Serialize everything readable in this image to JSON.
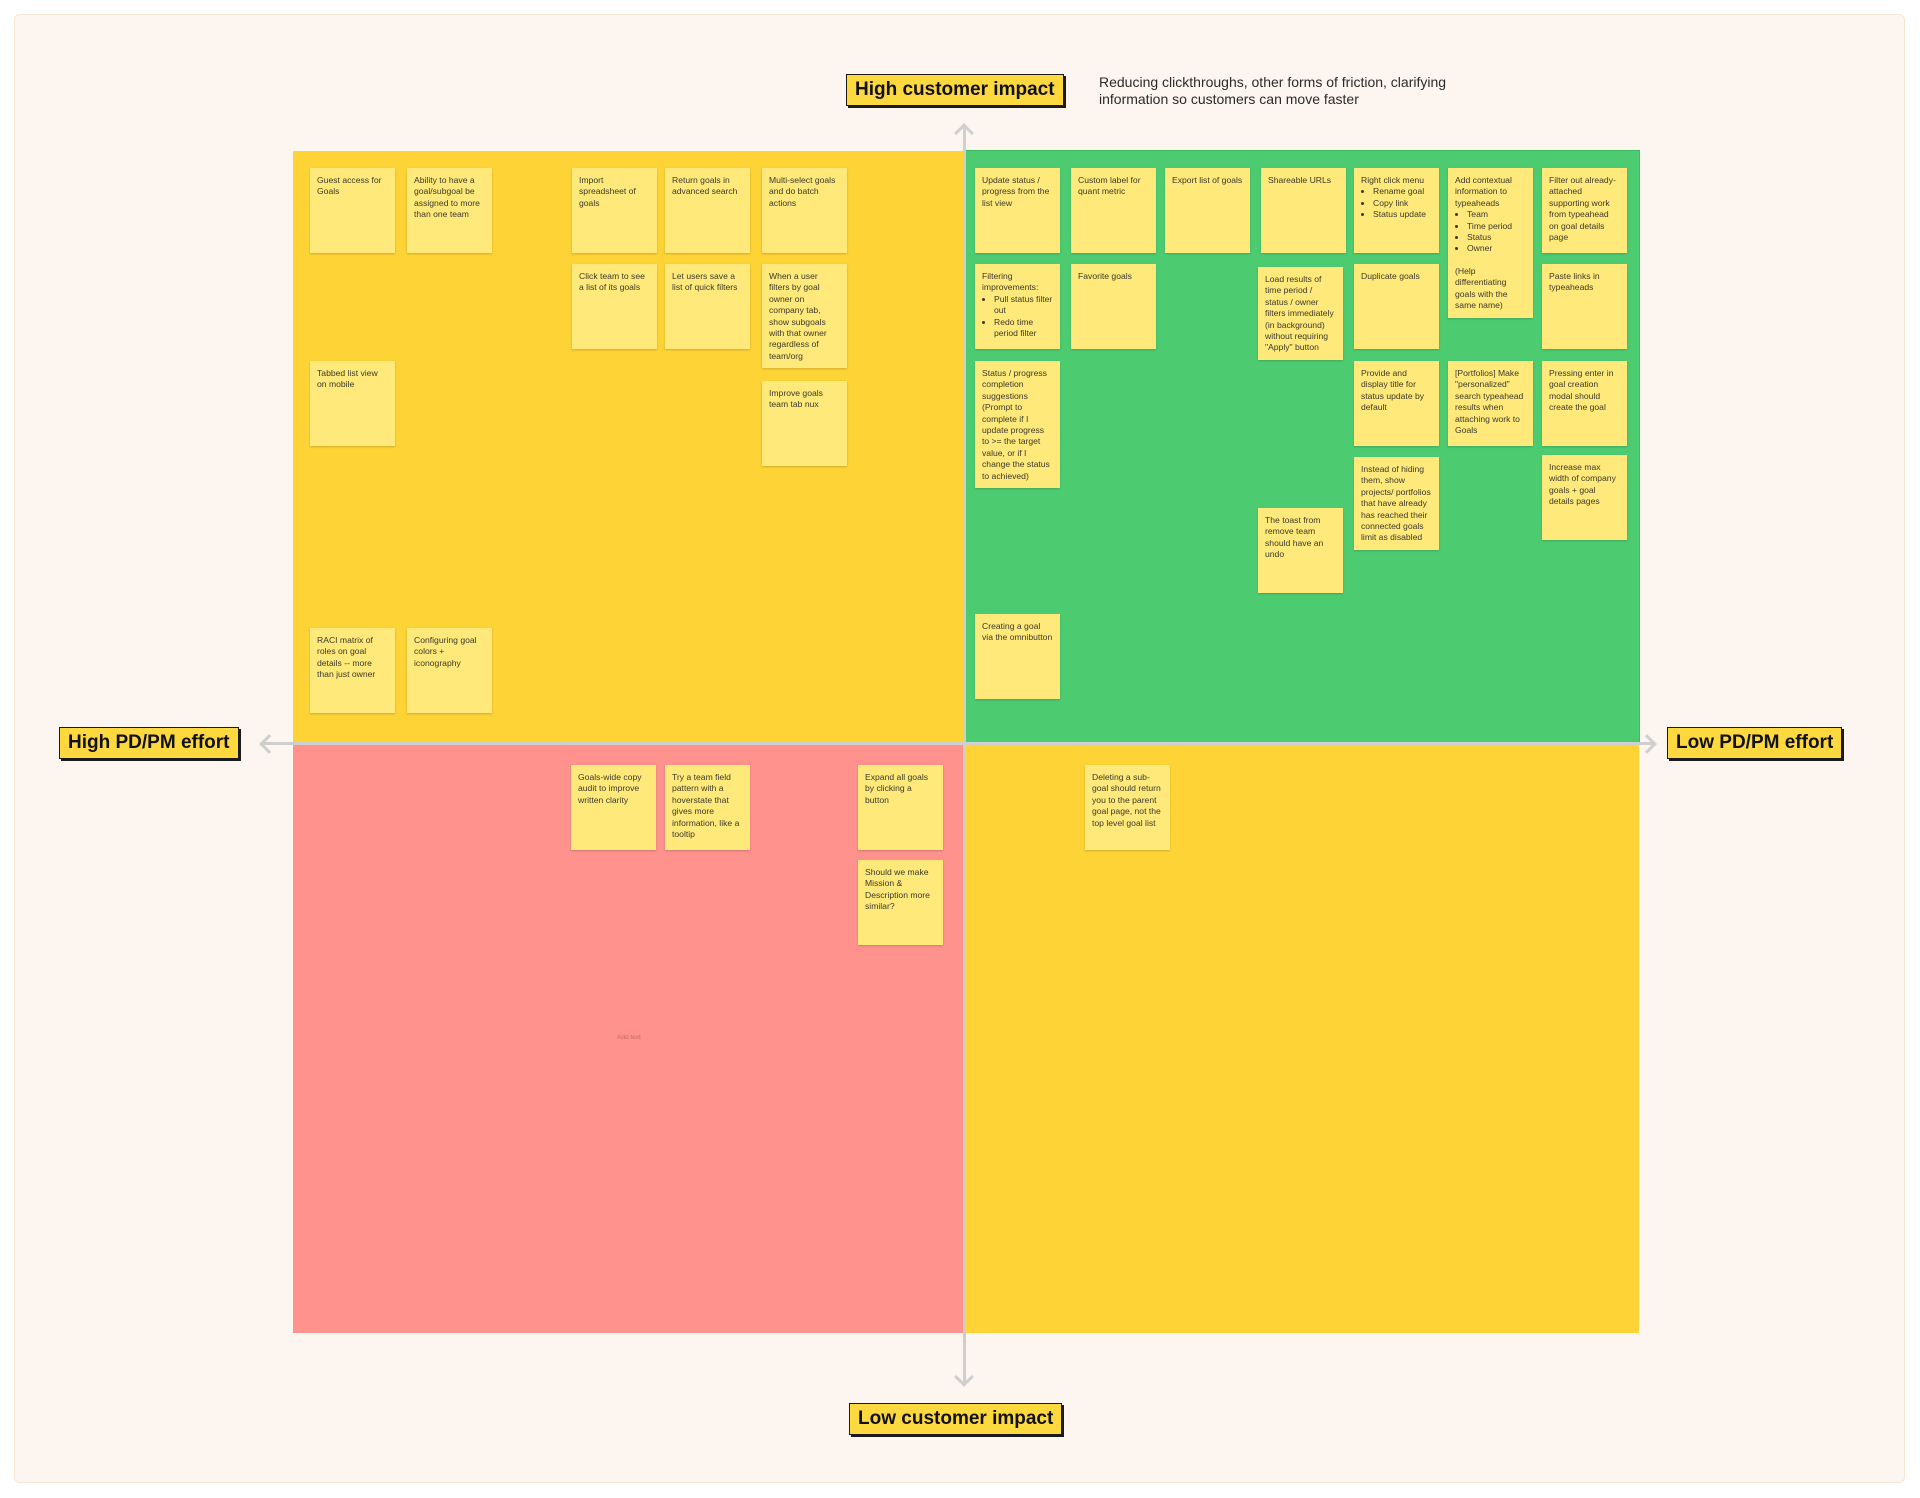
{
  "axes": {
    "top_label": "High customer impact",
    "bottom_label": "Low customer impact",
    "left_label": "High PD/PM effort",
    "right_label": "Low PD/PM effort",
    "top_description": "Reducing clickthroughs, other forms of friction, clarifying information so customers can move faster"
  },
  "colors": {
    "board": "#fdf6f0",
    "quadrant_top_left": "#fdd335",
    "quadrant_top_right": "#4dcb71",
    "quadrant_bottom_left": "#ff928c",
    "quadrant_bottom_right": "#fdd335",
    "sticky": "#ffe97a",
    "label_bg": "#fdd83f"
  },
  "quadrants": {
    "top_left": {
      "notes": [
        {
          "text": "Guest access for Goals"
        },
        {
          "text": "Ability to have a goal/subgoal be assigned to more than one team"
        },
        {
          "text": "Import spreadsheet of goals"
        },
        {
          "text": "Return goals in advanced search"
        },
        {
          "text": "Multi-select goals and do batch actions"
        },
        {
          "text": "Click team to see a list of its goals"
        },
        {
          "text": "Let users save a list of quick filters"
        },
        {
          "text": "When a user filters by goal owner on company tab, show subgoals with that owner regardless of team/org"
        },
        {
          "text": "Tabbed list view on mobile"
        },
        {
          "text": "Improve goals team tab nux"
        },
        {
          "text": "RACI matrix of roles on goal details -- more than just owner"
        },
        {
          "text": "Configuring goal colors + iconography"
        }
      ]
    },
    "top_right": {
      "notes": [
        {
          "text": "Update status / progress from the list view"
        },
        {
          "text": "Custom label for quant metric"
        },
        {
          "text": "Export list of goals"
        },
        {
          "text": "Shareable URLs"
        },
        {
          "text": "Right click menu",
          "bullets": [
            "Rename goal",
            "Copy link",
            "Status update"
          ]
        },
        {
          "text": "Add contextual information to typeaheads",
          "bullets": [
            "Team",
            "Time period",
            "Status",
            "Owner"
          ],
          "after": "(Help differentiating goals with the same name)"
        },
        {
          "text": "Filter out already-attached supporting work from typeahead on goal details page"
        },
        {
          "text": "Filtering improvements:",
          "bullets": [
            "Pull status filter out",
            "Redo time period filter"
          ]
        },
        {
          "text": "Favorite goals"
        },
        {
          "text": "Load results of time period / status / owner filters immediately (in background) without requiring \"Apply\" button"
        },
        {
          "text": "Duplicate goals"
        },
        {
          "text": "Paste links in typeaheads"
        },
        {
          "text": "Status / progress completion suggestions (Prompt to complete if I update progress to >= the target value, or if I change the status to achieved)"
        },
        {
          "text": "Provide and display title for status update by default"
        },
        {
          "text": "[Portfolios] Make \"personalized\" search typeahead results when attaching work to Goals"
        },
        {
          "text": "Pressing enter in goal creation modal should create the goal"
        },
        {
          "text": "Instead of hiding them, show projects/ portfolios that have already has reached their connected goals limit as disabled"
        },
        {
          "text": "Increase max width of company goals + goal details pages"
        },
        {
          "text": "The toast from remove team should have an undo"
        },
        {
          "text": "Creating a goal via the omnibutton"
        }
      ]
    },
    "bottom_left": {
      "notes": [
        {
          "text": "Goals-wide copy audit to improve written clarity"
        },
        {
          "text": "Try a team field pattern with a hoverstate that gives more information, like a tooltip"
        },
        {
          "text": "Expand all goals by clicking a button"
        },
        {
          "text": "Should we make Mission & Description more similar?"
        }
      ],
      "placeholder": "Add text"
    },
    "bottom_right": {
      "notes": [
        {
          "text": "Deleting a sub-goal should return you to the parent goal page, not the top level goal list"
        }
      ]
    }
  }
}
